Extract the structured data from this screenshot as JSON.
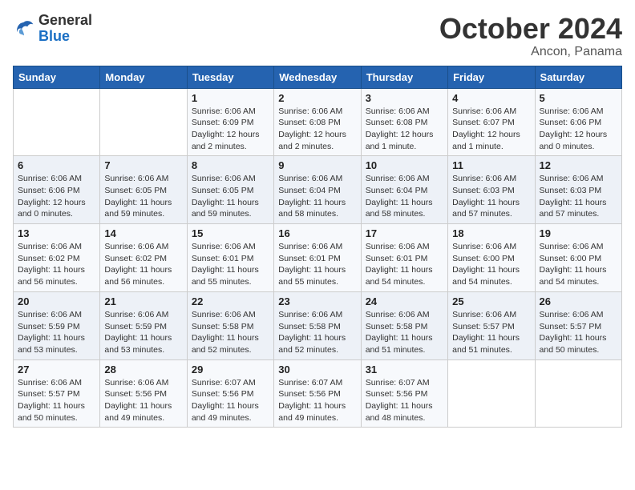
{
  "header": {
    "logo": {
      "general": "General",
      "blue": "Blue"
    },
    "title": "October 2024",
    "location": "Ancon, Panama"
  },
  "weekdays": [
    "Sunday",
    "Monday",
    "Tuesday",
    "Wednesday",
    "Thursday",
    "Friday",
    "Saturday"
  ],
  "weeks": [
    [
      {
        "day": "",
        "info": ""
      },
      {
        "day": "",
        "info": ""
      },
      {
        "day": "1",
        "info": "Sunrise: 6:06 AM\nSunset: 6:09 PM\nDaylight: 12 hours\nand 2 minutes."
      },
      {
        "day": "2",
        "info": "Sunrise: 6:06 AM\nSunset: 6:08 PM\nDaylight: 12 hours\nand 2 minutes."
      },
      {
        "day": "3",
        "info": "Sunrise: 6:06 AM\nSunset: 6:08 PM\nDaylight: 12 hours\nand 1 minute."
      },
      {
        "day": "4",
        "info": "Sunrise: 6:06 AM\nSunset: 6:07 PM\nDaylight: 12 hours\nand 1 minute."
      },
      {
        "day": "5",
        "info": "Sunrise: 6:06 AM\nSunset: 6:06 PM\nDaylight: 12 hours\nand 0 minutes."
      }
    ],
    [
      {
        "day": "6",
        "info": "Sunrise: 6:06 AM\nSunset: 6:06 PM\nDaylight: 12 hours\nand 0 minutes."
      },
      {
        "day": "7",
        "info": "Sunrise: 6:06 AM\nSunset: 6:05 PM\nDaylight: 11 hours\nand 59 minutes."
      },
      {
        "day": "8",
        "info": "Sunrise: 6:06 AM\nSunset: 6:05 PM\nDaylight: 11 hours\nand 59 minutes."
      },
      {
        "day": "9",
        "info": "Sunrise: 6:06 AM\nSunset: 6:04 PM\nDaylight: 11 hours\nand 58 minutes."
      },
      {
        "day": "10",
        "info": "Sunrise: 6:06 AM\nSunset: 6:04 PM\nDaylight: 11 hours\nand 58 minutes."
      },
      {
        "day": "11",
        "info": "Sunrise: 6:06 AM\nSunset: 6:03 PM\nDaylight: 11 hours\nand 57 minutes."
      },
      {
        "day": "12",
        "info": "Sunrise: 6:06 AM\nSunset: 6:03 PM\nDaylight: 11 hours\nand 57 minutes."
      }
    ],
    [
      {
        "day": "13",
        "info": "Sunrise: 6:06 AM\nSunset: 6:02 PM\nDaylight: 11 hours\nand 56 minutes."
      },
      {
        "day": "14",
        "info": "Sunrise: 6:06 AM\nSunset: 6:02 PM\nDaylight: 11 hours\nand 56 minutes."
      },
      {
        "day": "15",
        "info": "Sunrise: 6:06 AM\nSunset: 6:01 PM\nDaylight: 11 hours\nand 55 minutes."
      },
      {
        "day": "16",
        "info": "Sunrise: 6:06 AM\nSunset: 6:01 PM\nDaylight: 11 hours\nand 55 minutes."
      },
      {
        "day": "17",
        "info": "Sunrise: 6:06 AM\nSunset: 6:01 PM\nDaylight: 11 hours\nand 54 minutes."
      },
      {
        "day": "18",
        "info": "Sunrise: 6:06 AM\nSunset: 6:00 PM\nDaylight: 11 hours\nand 54 minutes."
      },
      {
        "day": "19",
        "info": "Sunrise: 6:06 AM\nSunset: 6:00 PM\nDaylight: 11 hours\nand 54 minutes."
      }
    ],
    [
      {
        "day": "20",
        "info": "Sunrise: 6:06 AM\nSunset: 5:59 PM\nDaylight: 11 hours\nand 53 minutes."
      },
      {
        "day": "21",
        "info": "Sunrise: 6:06 AM\nSunset: 5:59 PM\nDaylight: 11 hours\nand 53 minutes."
      },
      {
        "day": "22",
        "info": "Sunrise: 6:06 AM\nSunset: 5:58 PM\nDaylight: 11 hours\nand 52 minutes."
      },
      {
        "day": "23",
        "info": "Sunrise: 6:06 AM\nSunset: 5:58 PM\nDaylight: 11 hours\nand 52 minutes."
      },
      {
        "day": "24",
        "info": "Sunrise: 6:06 AM\nSunset: 5:58 PM\nDaylight: 11 hours\nand 51 minutes."
      },
      {
        "day": "25",
        "info": "Sunrise: 6:06 AM\nSunset: 5:57 PM\nDaylight: 11 hours\nand 51 minutes."
      },
      {
        "day": "26",
        "info": "Sunrise: 6:06 AM\nSunset: 5:57 PM\nDaylight: 11 hours\nand 50 minutes."
      }
    ],
    [
      {
        "day": "27",
        "info": "Sunrise: 6:06 AM\nSunset: 5:57 PM\nDaylight: 11 hours\nand 50 minutes."
      },
      {
        "day": "28",
        "info": "Sunrise: 6:06 AM\nSunset: 5:56 PM\nDaylight: 11 hours\nand 49 minutes."
      },
      {
        "day": "29",
        "info": "Sunrise: 6:07 AM\nSunset: 5:56 PM\nDaylight: 11 hours\nand 49 minutes."
      },
      {
        "day": "30",
        "info": "Sunrise: 6:07 AM\nSunset: 5:56 PM\nDaylight: 11 hours\nand 49 minutes."
      },
      {
        "day": "31",
        "info": "Sunrise: 6:07 AM\nSunset: 5:56 PM\nDaylight: 11 hours\nand 48 minutes."
      },
      {
        "day": "",
        "info": ""
      },
      {
        "day": "",
        "info": ""
      }
    ]
  ]
}
